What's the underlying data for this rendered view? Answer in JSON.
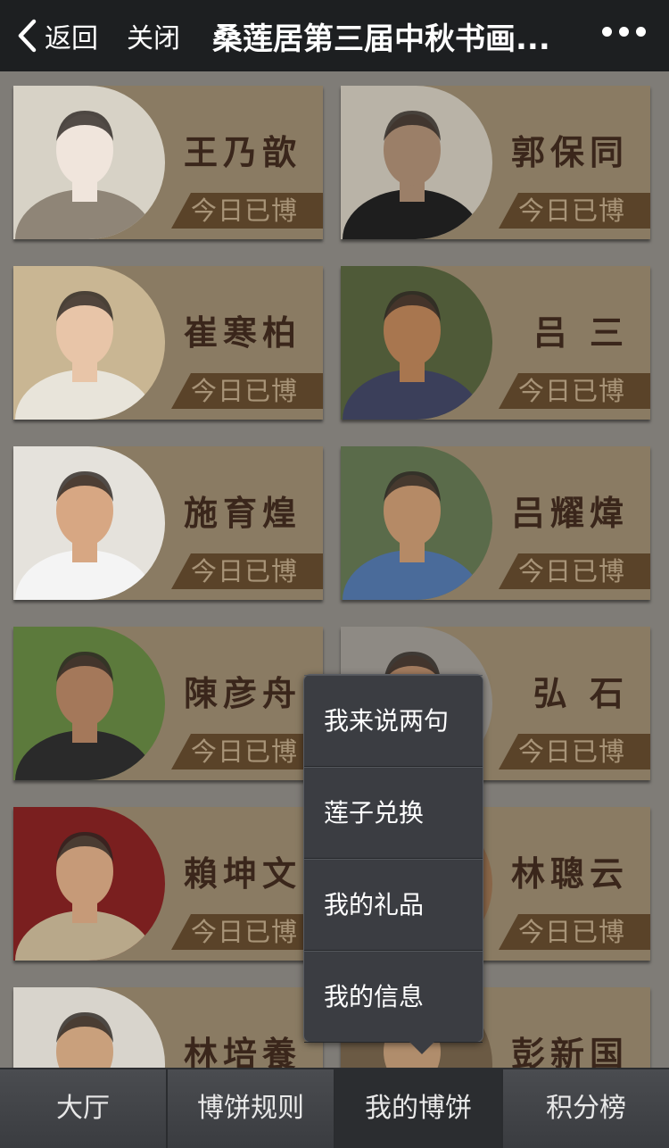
{
  "header": {
    "back_label": "返回",
    "close_label": "关闭",
    "title": "桑莲居第三届中秋书画..."
  },
  "artists": [
    {
      "name": "王乃歆",
      "status": "今日已博"
    },
    {
      "name": "郭保同",
      "status": "今日已博"
    },
    {
      "name": "崔寒柏",
      "status": "今日已博"
    },
    {
      "name": "吕 三",
      "status": "今日已博"
    },
    {
      "name": "施育煌",
      "status": "今日已博"
    },
    {
      "name": "吕耀煒",
      "status": "今日已博"
    },
    {
      "name": "陳彦舟",
      "status": "今日已博"
    },
    {
      "name": "弘 石",
      "status": "今日已博"
    },
    {
      "name": "賴坤文",
      "status": "今日已博"
    },
    {
      "name": "林聰云",
      "status": "今日已博"
    },
    {
      "name": "林培養",
      "status": ""
    },
    {
      "name": "彭新国",
      "status": ""
    }
  ],
  "popup_menu": {
    "items": [
      "我来说两句",
      "莲子兑换",
      "我的礼品",
      "我的信息"
    ]
  },
  "tabbar": {
    "tabs": [
      "大厅",
      "博饼规则",
      "我的博饼",
      "积分榜"
    ],
    "active": "我的博饼"
  }
}
